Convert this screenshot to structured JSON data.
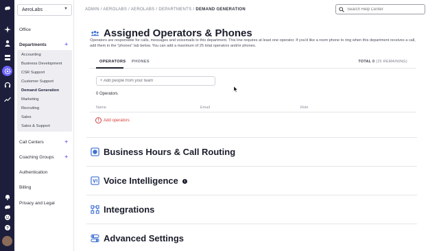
{
  "org": {
    "name": "AeroLabs"
  },
  "nav": {
    "office": "Office",
    "departments_heading": "Departments",
    "departments": [
      "Accounting",
      "Business Development",
      "CSR Support",
      "Customer Support",
      "Demand Generation",
      "Marketing",
      "Recruiting",
      "Sales",
      "Sales & Support"
    ],
    "active_department": "Demand Generation",
    "call_centers": "Call Centers",
    "coaching_groups": "Coaching Groups",
    "authentication": "Authentication",
    "billing": "Billing",
    "privacy": "Privacy and Legal",
    "plus": "+"
  },
  "breadcrumb": {
    "trail": "ADMIN / AEROLABS / AEROLABS / DEPARTMENTS / ",
    "current": "DEMAND GENERATION"
  },
  "search": {
    "placeholder": "Search Help Center"
  },
  "operators": {
    "title": "Assigned Operators & Phones",
    "description": "Operators are responsible for calls, messages and voicemails to this department. This line requires at least one operator. If you'd like a room phone to ring when this department receives a call, add them in the \"phones\" tab below. You can add a maximum of 25 total operators and/or phones.",
    "tabs": [
      "OPERATORS",
      "PHONES"
    ],
    "active_tab": "OPERATORS",
    "total_label": "TOTAL 0",
    "remaining_label": "(25 REMAINING)",
    "add_placeholder": "+ Add people from your team",
    "count_label": "0 Operators",
    "columns": [
      "Name",
      "Email",
      "Role"
    ],
    "warning": "Add operators",
    "warning_icon": "!"
  },
  "sections": [
    {
      "title": "Business Hours & Call Routing",
      "icon": "clock-icon"
    },
    {
      "title": "Voice Intelligence",
      "icon": "voice-intelligence-icon",
      "info": "i"
    },
    {
      "title": "Integrations",
      "icon": "integrations-icon"
    },
    {
      "title": "Advanced Settings",
      "icon": "toggles-icon"
    }
  ],
  "colors": {
    "rail": "#1c1e3b",
    "accent": "#6c63ff",
    "warning": "#d63a3a"
  }
}
